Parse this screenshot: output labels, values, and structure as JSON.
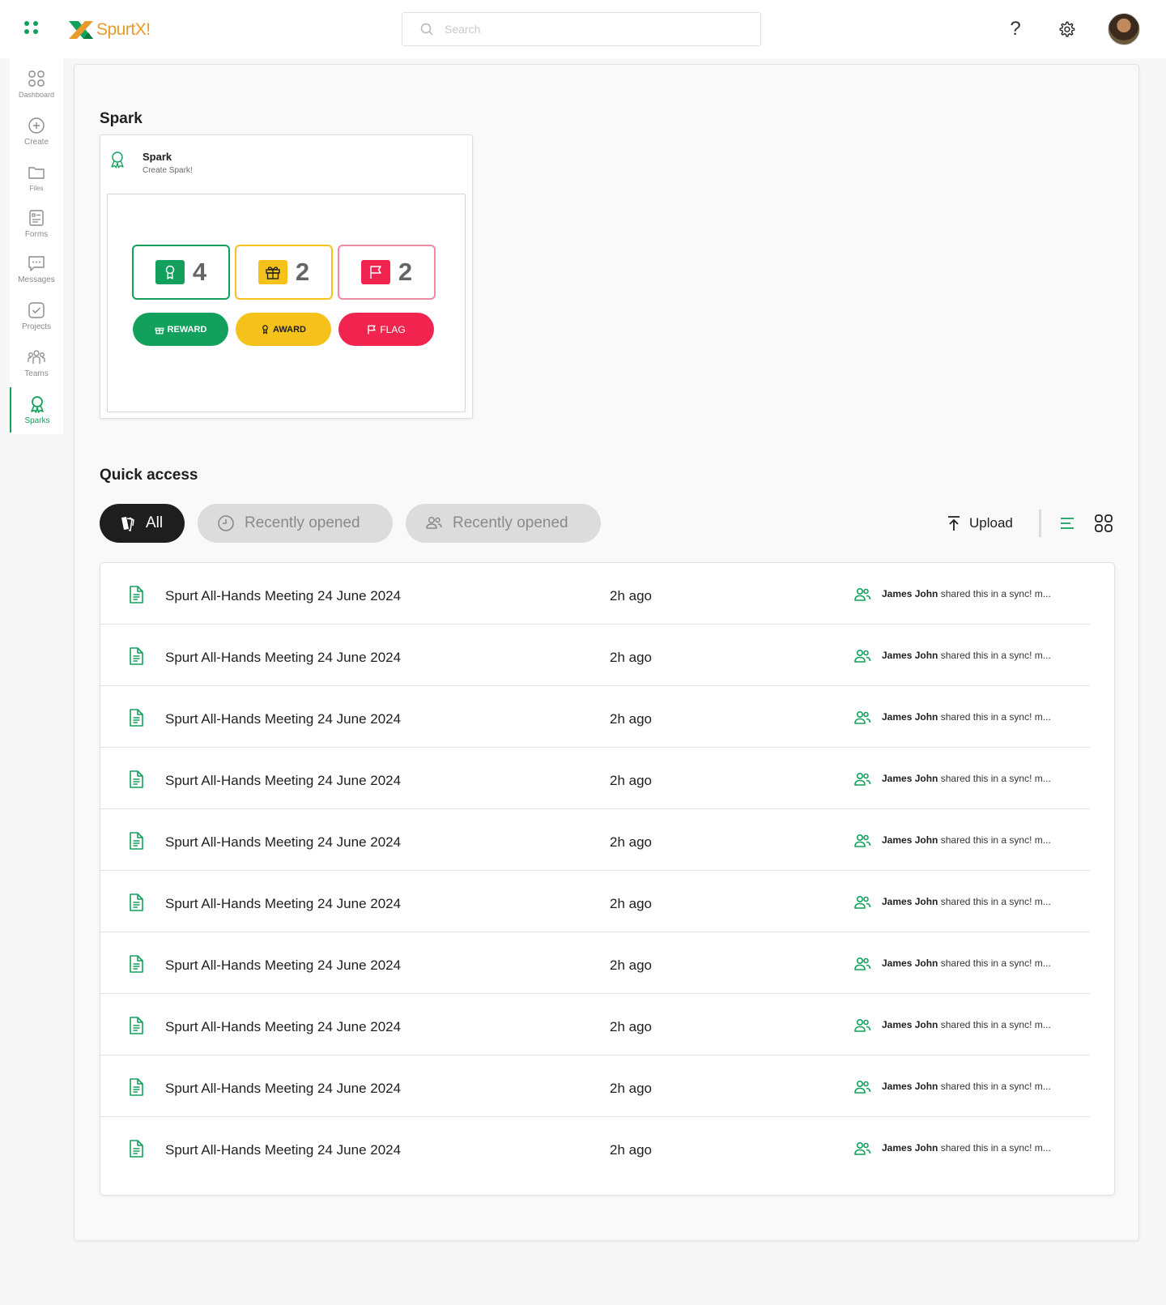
{
  "brand": {
    "name": "SpurtX!",
    "accent": "#12a05c",
    "logo_orange": "#e89a2b"
  },
  "header": {
    "search_placeholder": "Search",
    "help_label": "?"
  },
  "sidebar": {
    "items": [
      {
        "label": "Dashboard",
        "icon": "dashboard-icon"
      },
      {
        "label": "Create",
        "icon": "plus-circle-icon"
      },
      {
        "label": "Files",
        "icon": "folder-icon"
      },
      {
        "label": "Forms",
        "icon": "form-icon"
      },
      {
        "label": "Messages",
        "icon": "message-icon"
      },
      {
        "label": "Projects",
        "icon": "check-square-icon"
      },
      {
        "label": "Teams",
        "icon": "teams-icon"
      },
      {
        "label": "Sparks",
        "icon": "award-icon",
        "active": true
      }
    ]
  },
  "spark": {
    "section_title": "Spark",
    "card_title": "Spark",
    "card_subtitle": "Create Spark!",
    "counts": [
      {
        "kind": "award",
        "value": "4",
        "color": "#12a05c"
      },
      {
        "kind": "gift",
        "value": "2",
        "color": "#f5c21b"
      },
      {
        "kind": "flag",
        "value": "2",
        "color": "#f0244f"
      }
    ],
    "buttons": {
      "reward": "REWARD",
      "award": "AWARD",
      "flag": "FLAG"
    }
  },
  "quick_access": {
    "title": "Quick access",
    "filters": {
      "all": "All",
      "recent": "Recently opened",
      "shared": "Recently opened"
    },
    "upload_label": "Upload",
    "files": [
      {
        "name": "Spurt All-Hands Meeting 24 June 2024",
        "time": "2h ago",
        "shared_by": "James John",
        "shared_text": "shared this in a sync! m..."
      },
      {
        "name": "Spurt All-Hands Meeting 24 June 2024",
        "time": "2h ago",
        "shared_by": "James John",
        "shared_text": "shared this in a sync! m..."
      },
      {
        "name": "Spurt All-Hands Meeting 24 June 2024",
        "time": "2h ago",
        "shared_by": "James John",
        "shared_text": "shared this in a sync! m..."
      },
      {
        "name": "Spurt All-Hands Meeting 24 June 2024",
        "time": "2h ago",
        "shared_by": "James John",
        "shared_text": "shared this in a sync! m..."
      },
      {
        "name": "Spurt All-Hands Meeting 24 June 2024",
        "time": "2h ago",
        "shared_by": "James John",
        "shared_text": "shared this in a sync! m..."
      },
      {
        "name": "Spurt All-Hands Meeting 24 June 2024",
        "time": "2h ago",
        "shared_by": "James John",
        "shared_text": "shared this in a sync! m..."
      },
      {
        "name": "Spurt All-Hands Meeting 24 June 2024",
        "time": "2h ago",
        "shared_by": "James John",
        "shared_text": "shared this in a sync! m..."
      },
      {
        "name": "Spurt All-Hands Meeting 24 June 2024",
        "time": "2h ago",
        "shared_by": "James John",
        "shared_text": "shared this in a sync! m..."
      },
      {
        "name": "Spurt All-Hands Meeting 24 June 2024",
        "time": "2h ago",
        "shared_by": "James John",
        "shared_text": "shared this in a sync! m..."
      },
      {
        "name": "Spurt All-Hands Meeting 24 June 2024",
        "time": "2h ago",
        "shared_by": "James John",
        "shared_text": "shared this in a sync! m..."
      }
    ]
  }
}
